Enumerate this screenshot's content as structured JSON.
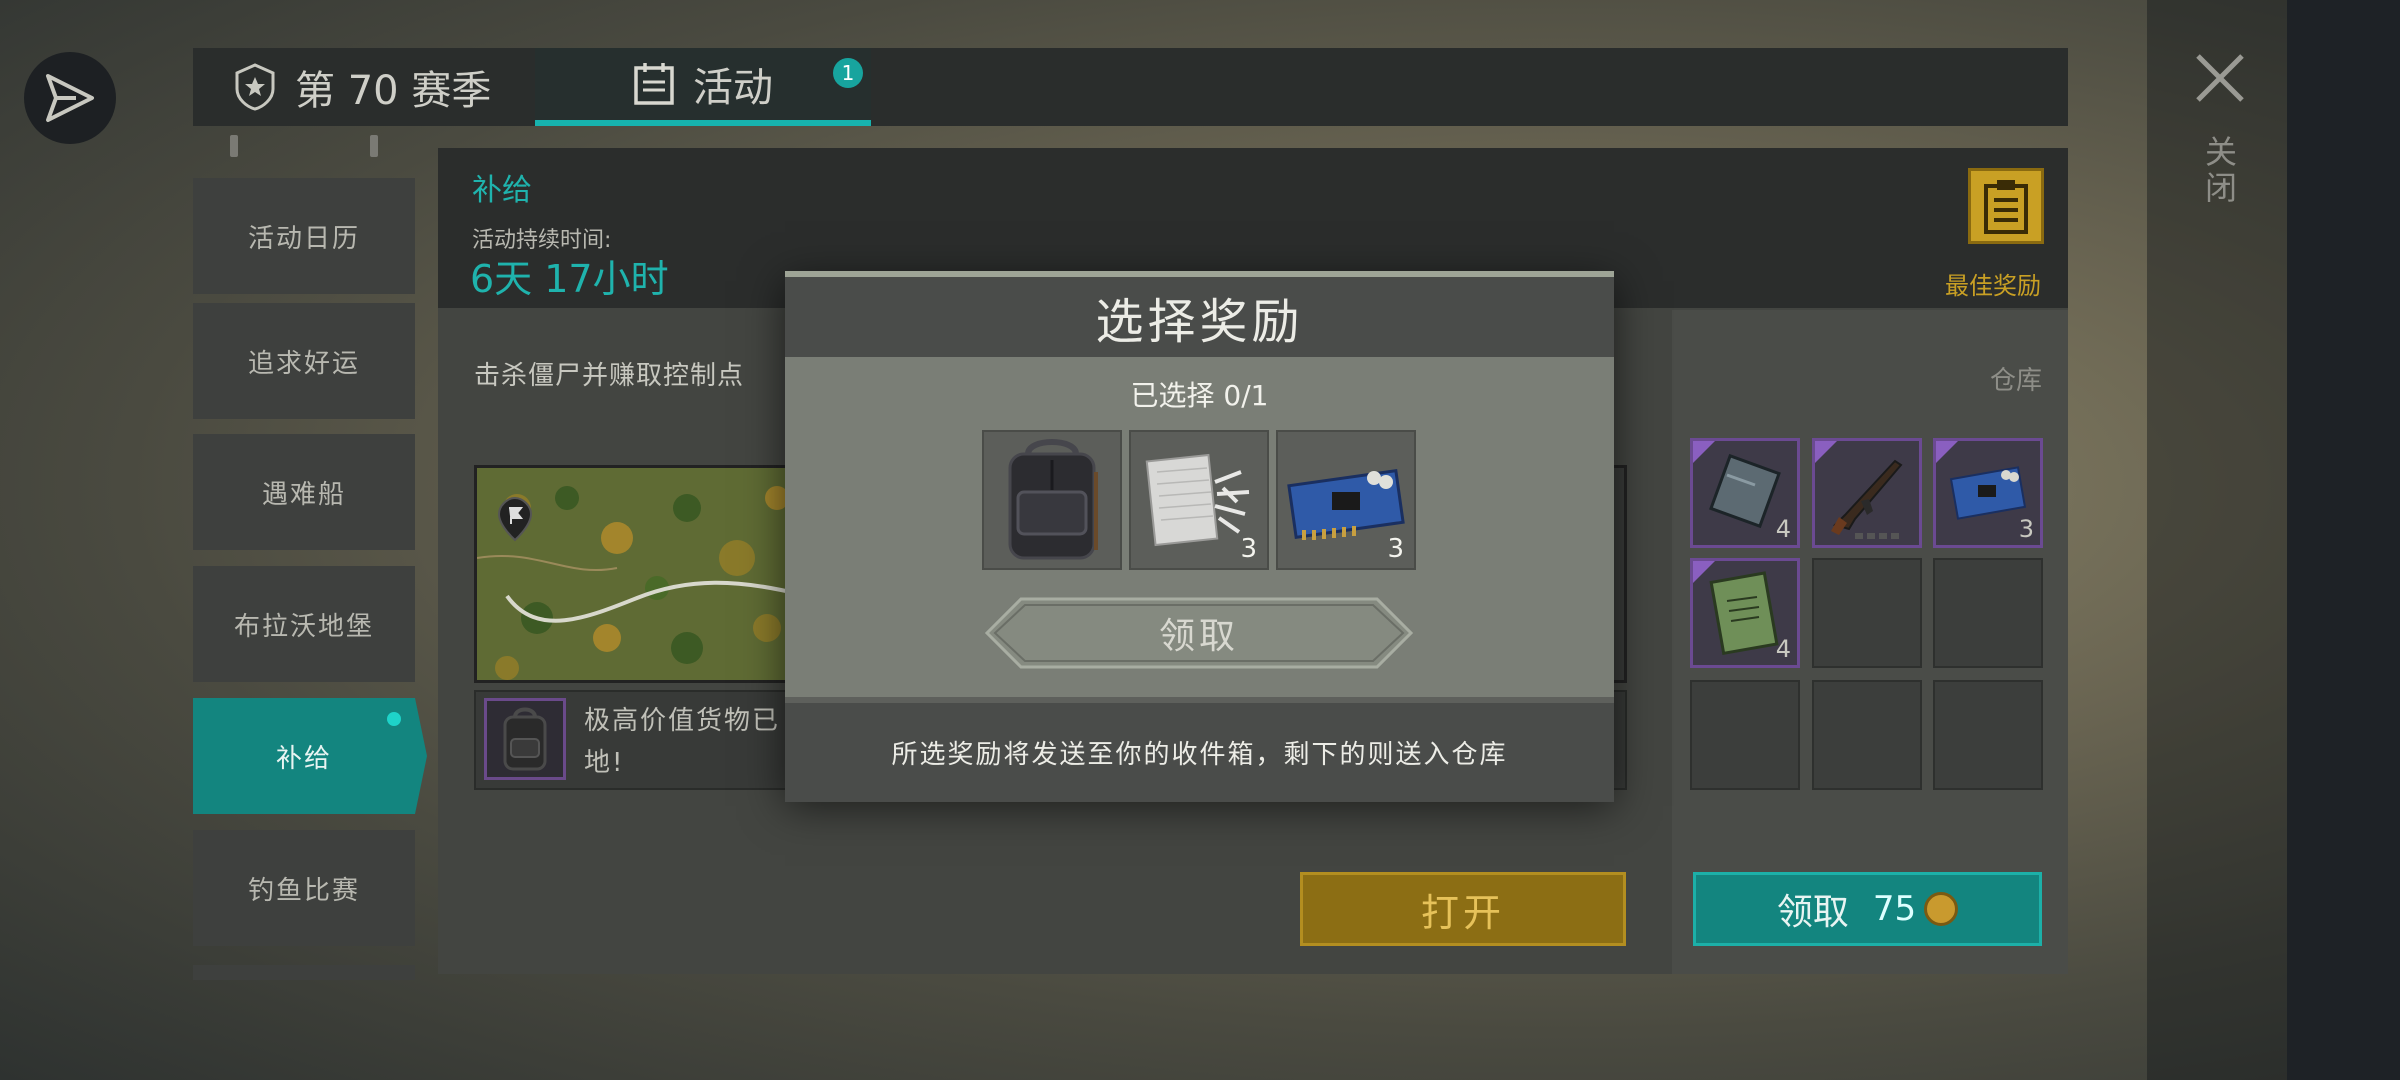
{
  "tabs": {
    "season_label": "第 70 赛季",
    "events_label": "活动",
    "events_badge": "1"
  },
  "close_label": "关闭",
  "sidebar": {
    "items": [
      {
        "label": "活动日历"
      },
      {
        "label": "追求好运"
      },
      {
        "label": "遇难船"
      },
      {
        "label": "布拉沃地堡"
      },
      {
        "label": "补给"
      },
      {
        "label": "钓鱼比赛"
      }
    ],
    "active_index": 4
  },
  "event": {
    "title": "补给",
    "duration_label": "活动持续时间:",
    "duration_value": "6天 17小时",
    "best_reward_label": "最佳奖励",
    "task_text": "击杀僵尸并赚取控制点",
    "info_line1": "极高价值货物已",
    "info_line2": "地!",
    "open_button": "打开"
  },
  "warehouse": {
    "label": "仓库",
    "slots": [
      {
        "item": "metal-plate-icon",
        "count": "4"
      },
      {
        "item": "rifle-icon",
        "count": ""
      },
      {
        "item": "circuit-board-icon",
        "count": "3"
      },
      {
        "item": "notebook-icon",
        "count": "4"
      },
      {
        "item": "",
        "count": ""
      },
      {
        "item": "",
        "count": ""
      },
      {
        "item": "",
        "count": ""
      },
      {
        "item": "",
        "count": ""
      },
      {
        "item": "",
        "count": ""
      }
    ],
    "claim_label": "领取",
    "claim_cost": "75"
  },
  "modal": {
    "title": "选择奖励",
    "selected_text": "已选择 0/1",
    "rewards": [
      {
        "item": "backpack-icon",
        "count": ""
      },
      {
        "item": "cloth-icon",
        "count": "3"
      },
      {
        "item": "circuit-board-icon",
        "count": "3"
      }
    ],
    "claim_button": "领取",
    "footer_text": "所选奖励将发送至你的收件箱，剩下的则送入仓库"
  },
  "colors": {
    "accent_teal": "#13857f",
    "highlight_teal": "#1fb3ad",
    "gold": "#c9a024",
    "rarity_purple": "#6b4a92"
  }
}
